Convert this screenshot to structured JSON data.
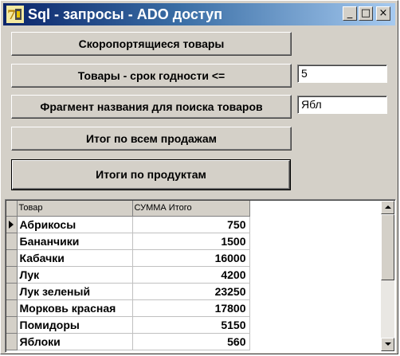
{
  "window": {
    "title": "Sql - запросы - ADO доступ",
    "icon": "delphi-7-icon",
    "controls": {
      "minimize": "_",
      "maximize": "□",
      "close": "×"
    }
  },
  "buttons": {
    "perishable": "Скоропортящиеся товары",
    "shelf_life": "Товары - срок годности <=",
    "name_fragment": "Фрагмент названия  для поиска товаров",
    "total_sales": "Итог по всем продажам",
    "product_totals": "Итоги по продуктам"
  },
  "inputs": {
    "shelf_life_days": "5",
    "name_fragment": "Ябл"
  },
  "grid": {
    "columns": [
      "Товар",
      "СУММА Итого"
    ],
    "rows": [
      {
        "name": "Абрикосы",
        "sum": "750"
      },
      {
        "name": "Бананчики",
        "sum": "1500"
      },
      {
        "name": "Кабачки",
        "sum": "16000"
      },
      {
        "name": "Лук",
        "sum": "4200"
      },
      {
        "name": "Лук зеленый",
        "sum": "23250"
      },
      {
        "name": "Морковь красная",
        "sum": "17800"
      },
      {
        "name": "Помидоры",
        "sum": "5150"
      },
      {
        "name": "Яблоки",
        "sum": "560"
      }
    ]
  }
}
